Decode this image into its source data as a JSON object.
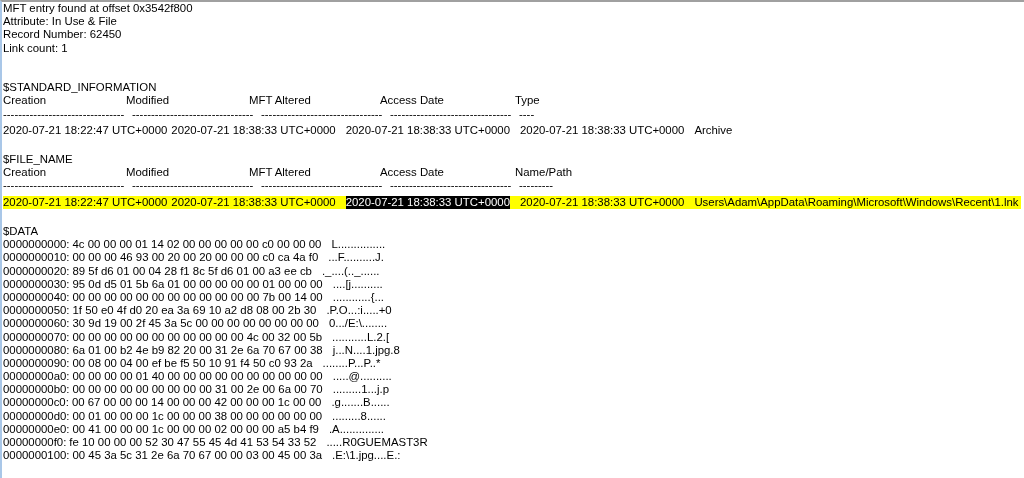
{
  "header_lines": [
    "MFT entry found at offset 0x3542f800",
    "Attribute: In Use & File",
    "Record Number: 62450",
    "Link count: 1"
  ],
  "standard_information": {
    "title": "$STANDARD_INFORMATION",
    "heading_labels": [
      "Creation",
      "Modified",
      "MFT Altered",
      "Access Date",
      "Type"
    ],
    "separators": [
      "--------------------------------",
      "--------------------------------",
      "--------------------------------",
      "--------------------------------",
      "----"
    ],
    "value_line": {
      "parts": [
        {
          "text": "2020-07-21 18:22:47 UTC+0000",
          "selected": false
        },
        {
          "text": "2020-07-21 18:38:33 UTC+0000",
          "selected": false
        },
        {
          "text": "2020-07-21 18:38:33 UTC+0000",
          "selected": false
        },
        {
          "text": "2020-07-21 18:38:33 UTC+0000",
          "selected": false
        },
        {
          "text": "Archive",
          "selected": false
        }
      ]
    }
  },
  "file_name": {
    "title": "$FILE_NAME",
    "heading_labels": [
      "Creation",
      "Modified",
      "MFT Altered",
      "Access Date",
      "Name/Path"
    ],
    "separators": [
      "--------------------------------",
      "--------------------------------",
      "--------------------------------",
      "--------------------------------",
      "---------"
    ],
    "value_line": {
      "highlighted": true,
      "parts": [
        {
          "text": "2020-07-21 18:22:47 UTC+0000",
          "selected": false
        },
        {
          "text": "2020-07-21 18:38:33 UTC+0000",
          "selected": false
        },
        {
          "text": "2020-07-21 18:38:33 UTC+0000",
          "selected": true
        },
        {
          "text": "2020-07-21 18:38:33 UTC+0000",
          "selected": false
        },
        {
          "text": "Users\\Adam\\AppData\\Roaming\\Microsoft\\Windows\\Recent\\1.lnk",
          "selected": false
        }
      ]
    }
  },
  "data": {
    "title": "$DATA",
    "lines": [
      {
        "offset": "0000000000:",
        "hex": "4c 00 00 00 01 14 02 00 00 00 00 00 c0 00 00 00",
        "ascii": "L..............."
      },
      {
        "offset": "0000000010:",
        "hex": "00 00 00 46 93 00 20 00 20 00 00 00 c0 ca 4a f0",
        "ascii": "...F..........J."
      },
      {
        "offset": "0000000020:",
        "hex": "89 5f d6 01 00 04 28 f1 8c 5f d6 01 00 a3 ee cb",
        "ascii": "._....(.._......"
      },
      {
        "offset": "0000000030:",
        "hex": "95 0d d5 01 5b 6a 01 00 00 00 00 00 01 00 00 00",
        "ascii": "....[j.........."
      },
      {
        "offset": "0000000040:",
        "hex": "00 00 00 00 00 00 00 00 00 00 00 00 7b 00 14 00",
        "ascii": "............{..."
      },
      {
        "offset": "0000000050:",
        "hex": "1f 50 e0 4f d0 20 ea 3a 69 10 a2 d8 08 00 2b 30",
        "ascii": ".P.O...:i.....+0"
      },
      {
        "offset": "0000000060:",
        "hex": "30 9d 19 00 2f 45 3a 5c 00 00 00 00 00 00 00 00",
        "ascii": "0.../E:\\........"
      },
      {
        "offset": "0000000070:",
        "hex": "00 00 00 00 00 00 00 00 00 00 00 4c 00 32 00 5b",
        "ascii": "...........L.2.["
      },
      {
        "offset": "0000000080:",
        "hex": "6a 01 00 b2 4e b9 82 20 00 31 2e 6a 70 67 00 38",
        "ascii": "j...N....1.jpg.8"
      },
      {
        "offset": "0000000090:",
        "hex": "00 08 00 04 00 ef be f5 50 10 91 f4 50 c0 93 2a",
        "ascii": "........P...P..*"
      },
      {
        "offset": "00000000a0:",
        "hex": "00 00 00 00 01 40 00 00 00 00 00 00 00 00 00 00",
        "ascii": ".....@.........."
      },
      {
        "offset": "00000000b0:",
        "hex": "00 00 00 00 00 00 00 00 00 31 00 2e 00 6a 00 70",
        "ascii": ".........1...j.p"
      },
      {
        "offset": "00000000c0:",
        "hex": "00 67 00 00 00 14 00 00 00 42 00 00 00 1c 00 00",
        "ascii": ".g.......B......"
      },
      {
        "offset": "00000000d0:",
        "hex": "00 01 00 00 00 1c 00 00 00 38 00 00 00 00 00 00",
        "ascii": ".........8......"
      },
      {
        "offset": "00000000e0:",
        "hex": "00 41 00 00 00 1c 00 00 00 02 00 00 00 a5 b4 f9",
        "ascii": ".A.............."
      },
      {
        "offset": "00000000f0:",
        "hex": "fe 10 00 00 00 52 30 47 55 45 4d 41 53 54 33 52",
        "ascii": ".....R0GUEMAST3R"
      },
      {
        "offset": "0000000100:",
        "hex": "00 45 3a 5c 31 2e 6a 70 67 00 00 03 00 45 00 3a",
        "ascii": ".E:\\1.jpg....E.:"
      }
    ]
  }
}
